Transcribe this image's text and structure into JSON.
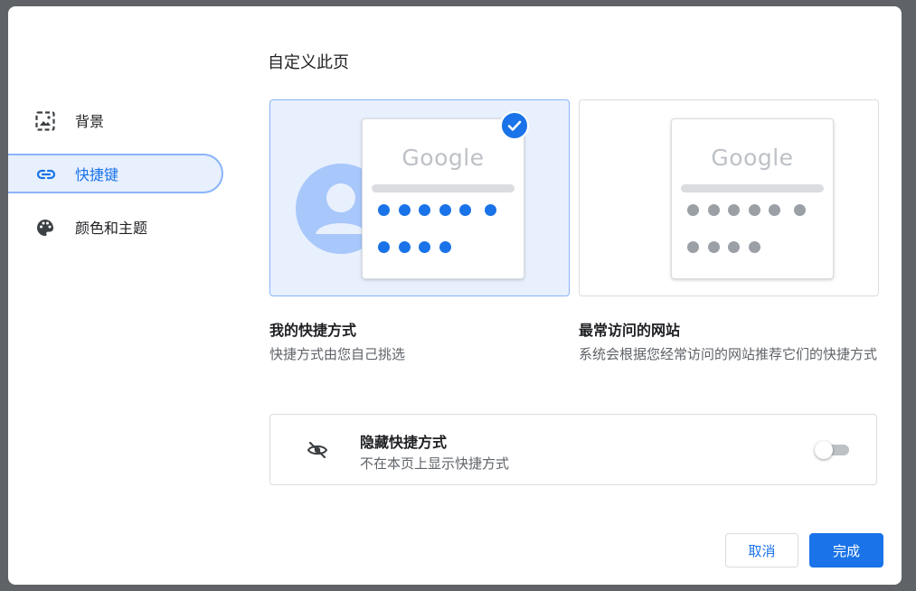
{
  "dialog": {
    "title": "自定义此页"
  },
  "sidebar": {
    "items": [
      {
        "label": "背景",
        "icon": "wallpaper-icon",
        "active": false
      },
      {
        "label": "快捷键",
        "icon": "link-icon",
        "active": true
      },
      {
        "label": "颜色和主题",
        "icon": "palette-icon",
        "active": false
      }
    ]
  },
  "options": [
    {
      "title": "我的快捷方式",
      "description": "快捷方式由您自己挑选",
      "logo": "Google",
      "selected": true
    },
    {
      "title": "最常访问的网站",
      "description": "系统会根据您经常访问的网站推荐它们的快捷方式",
      "logo": "Google",
      "selected": false
    }
  ],
  "hide_shortcuts": {
    "title": "隐藏快捷方式",
    "subtitle": "不在本页上显示快捷方式",
    "icon": "visibility-off-icon",
    "enabled": false
  },
  "buttons": {
    "cancel": "取消",
    "done": "完成"
  },
  "colors": {
    "accent": "#1a73e8",
    "selected_bg": "#e8f0fe",
    "text_primary": "#202124",
    "text_secondary": "#5f6368"
  }
}
